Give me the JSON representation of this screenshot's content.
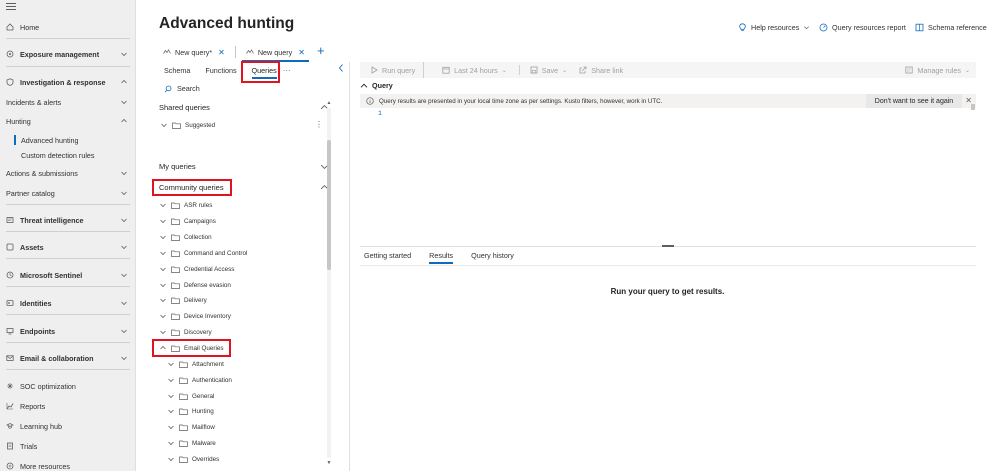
{
  "nav": {
    "items": [
      {
        "label": "Home",
        "icon": "home-icon"
      },
      {
        "label": "Exposure management",
        "icon": "exposure-icon"
      },
      {
        "label": "Investigation & response",
        "icon": "investigation-icon"
      },
      {
        "label": "Incidents & alerts"
      },
      {
        "label": "Hunting"
      },
      {
        "label": "Advanced hunting"
      },
      {
        "label": "Custom detection rules"
      },
      {
        "label": "Actions & submissions"
      },
      {
        "label": "Partner catalog"
      },
      {
        "label": "Threat intelligence",
        "icon": "threat-intel-icon"
      },
      {
        "label": "Assets",
        "icon": "assets-icon"
      },
      {
        "label": "Microsoft Sentinel",
        "icon": "sentinel-icon"
      },
      {
        "label": "Identities",
        "icon": "identities-icon"
      },
      {
        "label": "Endpoints",
        "icon": "endpoints-icon"
      },
      {
        "label": "Email & collaboration",
        "icon": "email-icon"
      },
      {
        "label": "SOC optimization",
        "icon": "soc-icon"
      },
      {
        "label": "Reports",
        "icon": "reports-icon"
      },
      {
        "label": "Learning hub",
        "icon": "learning-icon"
      },
      {
        "label": "Trials",
        "icon": "trials-icon"
      },
      {
        "label": "More resources",
        "icon": "more-resources-icon"
      }
    ]
  },
  "header": {
    "title": "Advanced hunting",
    "help_resources": "Help resources",
    "query_resources_report": "Query resources report",
    "schema_reference": "Schema reference"
  },
  "tabs": [
    {
      "label": "New query*"
    },
    {
      "label": "New query"
    }
  ],
  "panel": {
    "subtabs": [
      "Schema",
      "Functions",
      "Queries"
    ],
    "more": "···",
    "search_placeholder": "Search",
    "shared_queries": "Shared queries",
    "suggested": "Suggested",
    "my_queries": "My queries",
    "community_queries": "Community queries",
    "community_folders": [
      "ASR rules",
      "Campaigns",
      "Collection",
      "Command and Control",
      "Credential Access",
      "Defense evasion",
      "Delivery",
      "Device Inventory",
      "Discovery",
      "Email Queries"
    ],
    "email_subfolders": [
      "Attachment",
      "Authentication",
      "General",
      "Hunting",
      "Mailflow",
      "Malware",
      "Overrides"
    ]
  },
  "toolbar": {
    "run_query": "Run query",
    "time_range": "Last 24 hours",
    "save": "Save",
    "share_link": "Share link",
    "manage_rules": "Manage rules"
  },
  "editor": {
    "query_label": "Query",
    "info_text": "Query results are presented in your local time zone as per settings. Kusto filters, however, work in UTC.",
    "dismiss": "Don't want to see it again",
    "line_number": "1"
  },
  "results": {
    "tabs": [
      "Getting started",
      "Results",
      "Query history"
    ],
    "empty_message": "Run your query to get results."
  },
  "colors": {
    "accent": "#0f6cbd",
    "highlight": "#e0141e",
    "nav_bg": "#efefef"
  }
}
